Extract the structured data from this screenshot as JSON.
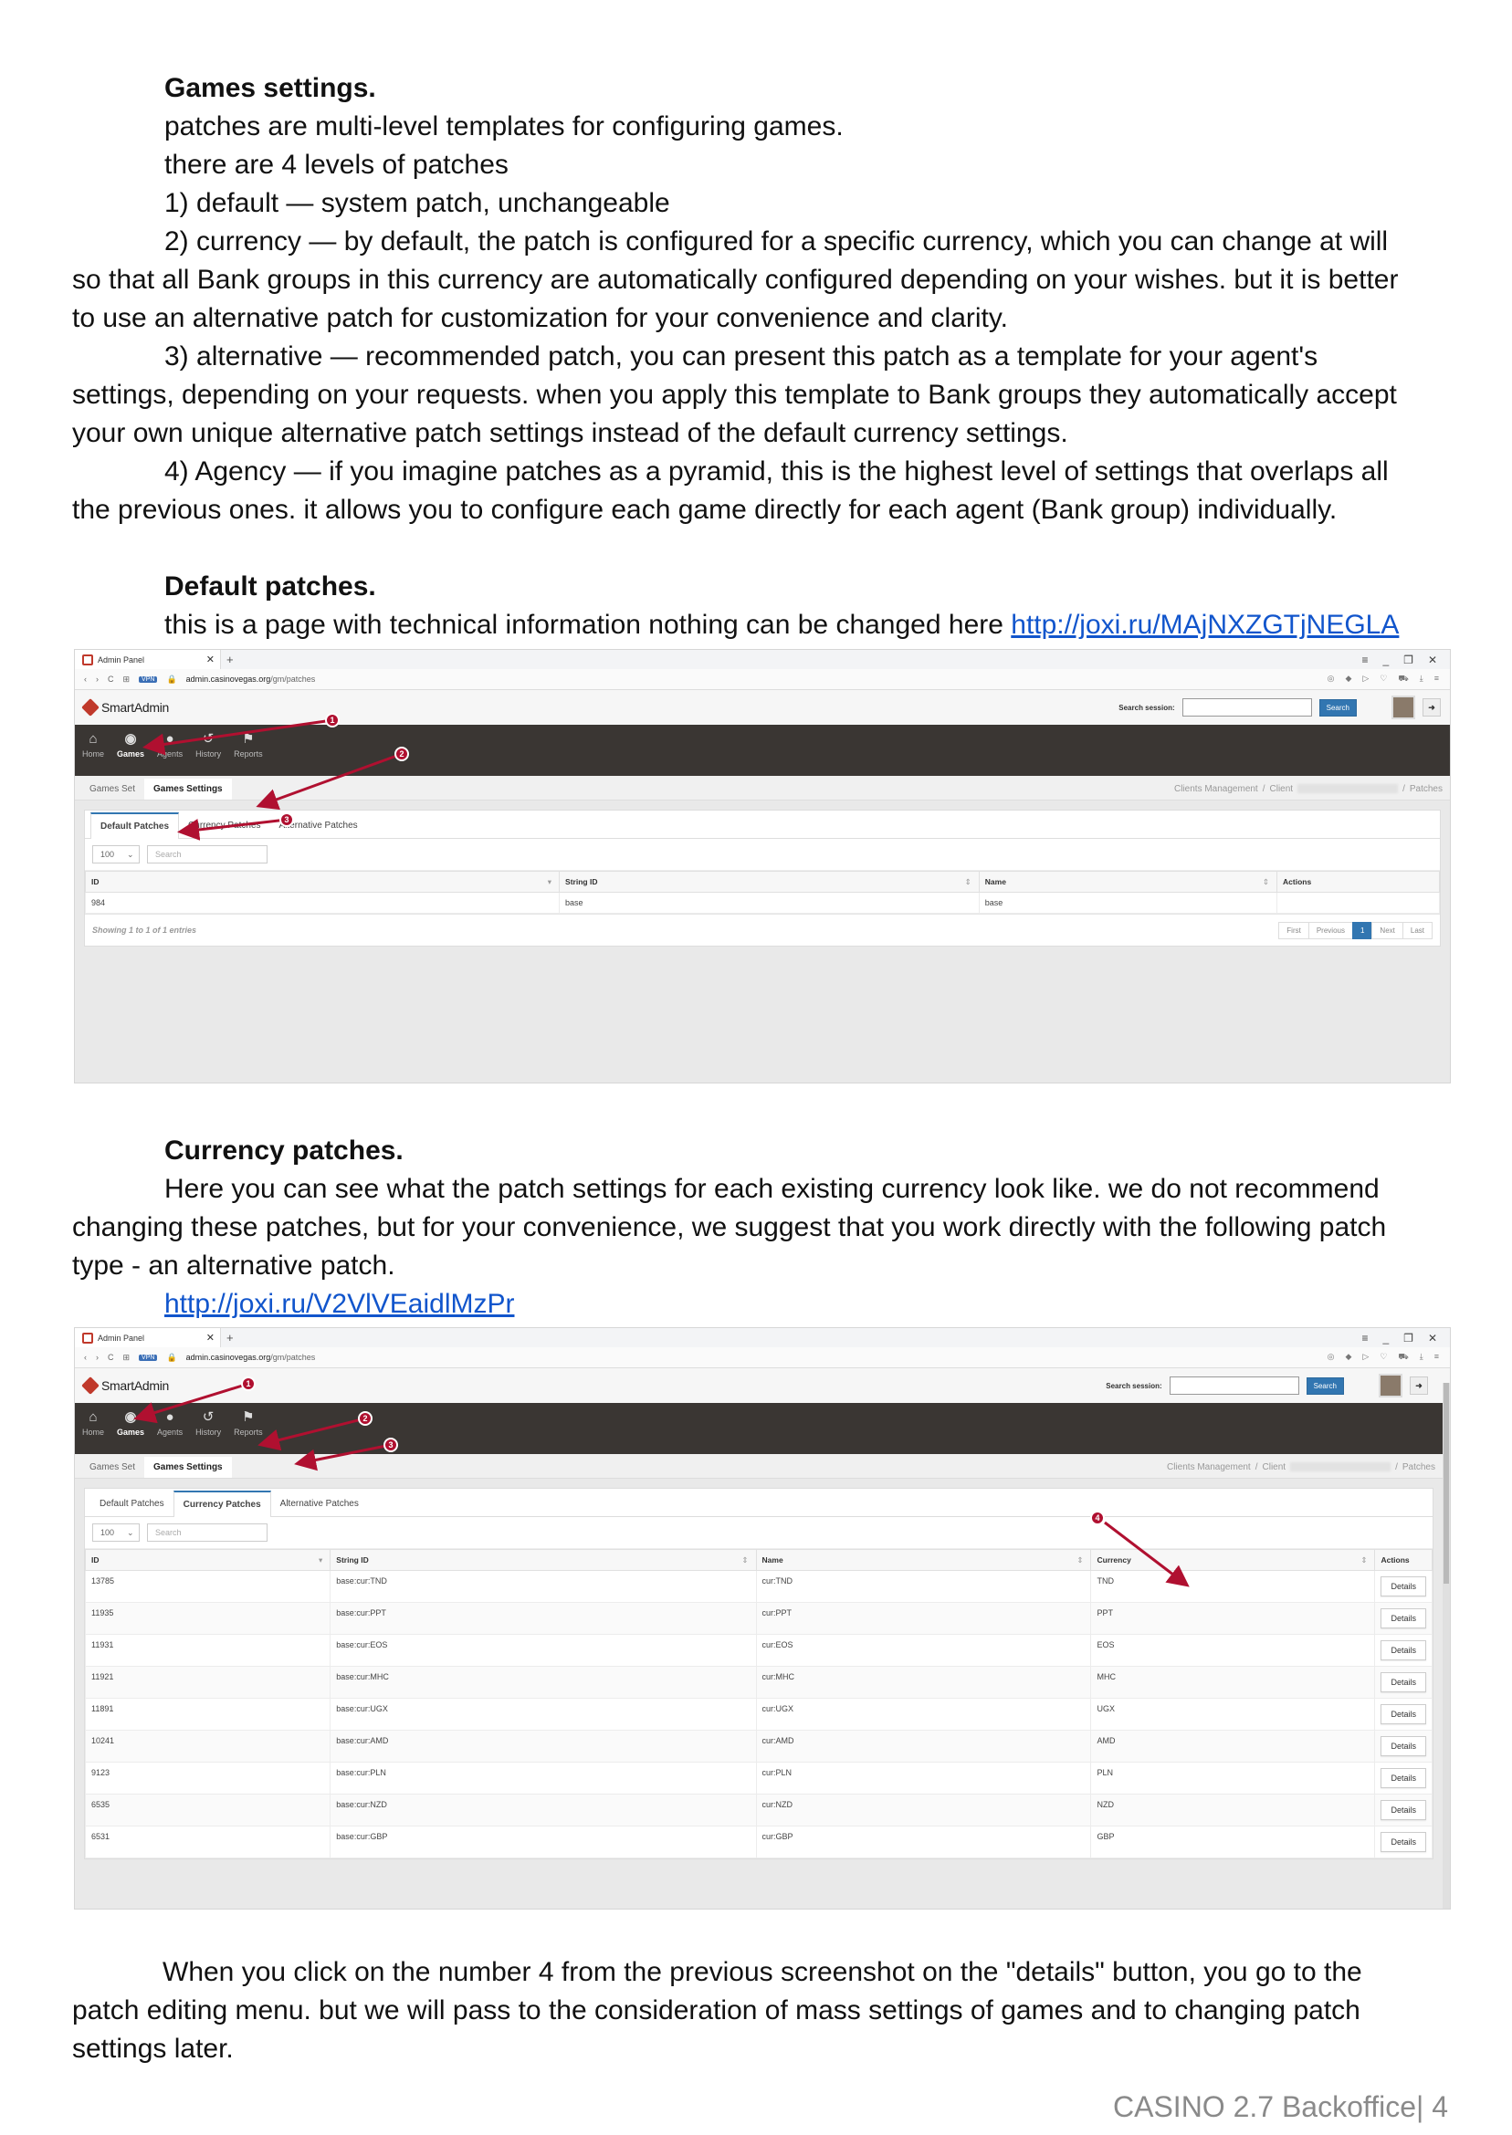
{
  "intro": {
    "heading": "Games settings.",
    "line1": "patches are multi-level templates for configuring games.",
    "line2": "there are 4 levels of patches",
    "item1": "1) default — system patch, unchangeable",
    "item2_first": "2) currency — by default, the patch is configured for a specific currency, which you can change at will",
    "item2_rest1": "so that all Bank groups in this currency are automatically configured depending on your wishes. but it is better",
    "item2_rest2": "to use an alternative patch for customization for your convenience and clarity.",
    "item3_first": "3) alternative — recommended patch, you can present this patch as a template for your agent's",
    "item3_rest1": "settings, depending on your requests. when you apply this template to Bank groups they automatically accept",
    "item3_rest2": "your own unique alternative patch settings instead of the default currency settings.",
    "item4_first": "4) Agency — if you imagine patches as a pyramid, this is the highest level of settings that overlaps all",
    "item4_rest1": "the previous ones. it allows you to configure each game directly for each agent (Bank group) individually."
  },
  "default_section": {
    "heading": "Default patches.",
    "text": "this is a page with technical information nothing can be changed here ",
    "link": "http://joxi.ru/MAjNXZGTjNEGLA"
  },
  "currency_section": {
    "heading": "Currency patches.",
    "text_first": "Here you can see what the patch settings for each existing currency look like. we do not recommend",
    "text_rest1": "changing these patches, but for your convenience, we suggest that you work directly with the following patch",
    "text_rest2": "type - an alternative patch.",
    "link": "http://joxi.ru/V2VlVEaidlMzPr"
  },
  "closing": {
    "text_first": "When you click on the number 4 from the previous screenshot on the \"details\" button, you go to the",
    "text_rest1": "patch editing menu. but we will pass to the consideration of mass settings of games and to changing patch",
    "text_rest2": "settings later."
  },
  "footer": "CASINO 2.7 Backoffice| 4",
  "app": {
    "browser_tab": "Admin Panel",
    "url_host": "admin.casinovegas.org",
    "url_path": "/gm/patches",
    "vpn": "VPN",
    "brand": "SmartAdmin",
    "search_label": "Search session:",
    "search_button": "Search",
    "nav": [
      "Home",
      "Games",
      "Agents",
      "History",
      "Reports"
    ],
    "subtabs": [
      "Games Set",
      "Games Settings"
    ],
    "crumb_clients": "Clients Management",
    "crumb_client": "Client",
    "crumb_patches": "Patches",
    "patch_tabs": [
      "Default Patches",
      "Currency Patches",
      "Alternative Patches"
    ],
    "page_size": "100",
    "search_placeholder": "Search"
  },
  "default_table": {
    "headers": [
      "ID",
      "String ID",
      "Name",
      "Actions"
    ],
    "rows": [
      [
        "984",
        "base",
        "base"
      ]
    ],
    "info": "Showing 1 to 1 of 1 entries",
    "pager": [
      "First",
      "Previous",
      "1",
      "Next",
      "Last"
    ]
  },
  "currency_table": {
    "headers": [
      "ID",
      "String ID",
      "Name",
      "Currency",
      "Actions"
    ],
    "details_label": "Details",
    "rows": [
      [
        "13785",
        "base:cur:TND",
        "cur:TND",
        "TND"
      ],
      [
        "11935",
        "base:cur:PPT",
        "cur:PPT",
        "PPT"
      ],
      [
        "11931",
        "base:cur:EOS",
        "cur:EOS",
        "EOS"
      ],
      [
        "11921",
        "base:cur:MHC",
        "cur:MHC",
        "MHC"
      ],
      [
        "11891",
        "base:cur:UGX",
        "cur:UGX",
        "UGX"
      ],
      [
        "10241",
        "base:cur:AMD",
        "cur:AMD",
        "AMD"
      ],
      [
        "9123",
        "base:cur:PLN",
        "cur:PLN",
        "PLN"
      ],
      [
        "6535",
        "base:cur:NZD",
        "cur:NZD",
        "NZD"
      ],
      [
        "6531",
        "base:cur:GBP",
        "cur:GBP",
        "GBP"
      ]
    ]
  },
  "markers": [
    "1",
    "2",
    "3",
    "4"
  ],
  "colors": {
    "marker": "#b01030",
    "link": "#1155cc",
    "primary": "#3276b1",
    "navbar": "#3a3633"
  }
}
